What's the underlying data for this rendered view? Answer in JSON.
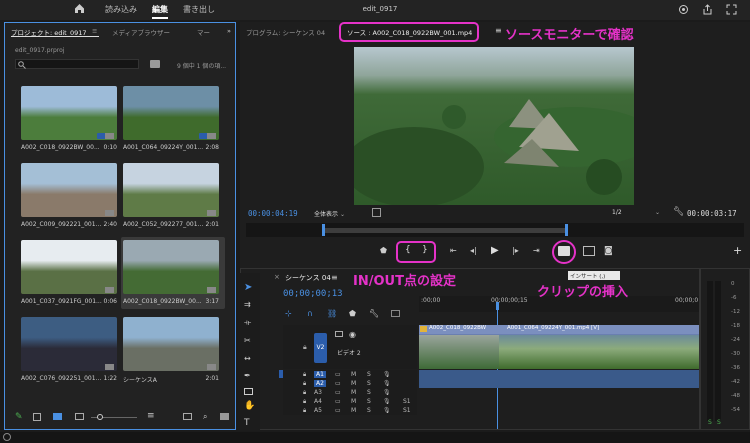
{
  "window": {
    "title": "edit_0917",
    "tabs": [
      "読み込み",
      "編集",
      "書き出し"
    ],
    "active_tab": 1
  },
  "project": {
    "tab_label": "プロジェクト: edit_0917",
    "media_browser": "メディアブラウザー",
    "more": "マー",
    "file": "edit_0917.prproj",
    "count": "9 個中 1 個の項...",
    "items": [
      {
        "name": "A002_C018_0922BW_00...",
        "dur": "0:10",
        "sky": "#9dbbd8",
        "ground": "#4c7d3c",
        "badge": true
      },
      {
        "name": "A001_C064_09224Y_001...",
        "dur": "2:08",
        "sky": "#6d8fa6",
        "ground": "#3f6b2c",
        "badge": true
      },
      {
        "name": "A002_C009_092221_001...",
        "dur": "2:40",
        "sky": "#a4bfd6",
        "ground": "#8a7a6a",
        "badge": false
      },
      {
        "name": "A002_C052_092277_001...",
        "dur": "2:01",
        "sky": "#c6d3e0",
        "ground": "#5f7b47",
        "badge": false
      },
      {
        "name": "A001_C037_0921FG_001...",
        "dur": "0:06",
        "sky": "#e7ecf0",
        "ground": "#5a7045",
        "badge": false
      },
      {
        "name": "A002_C018_0922BW_00...",
        "dur": "3:17",
        "sky": "#9aa9b2",
        "ground": "#446b34",
        "badge": false,
        "selected": true
      },
      {
        "name": "A002_C076_092251_001...",
        "dur": "1:22",
        "sky": "#3d5d82",
        "ground": "#2b2b38",
        "badge": false
      },
      {
        "name": "シーケンスA",
        "dur": "2:01",
        "sky": "#8fb1cf",
        "ground": "#6a6f64",
        "badge": false
      }
    ]
  },
  "program": {
    "label": "プログラム: シーケンス 04"
  },
  "source": {
    "label": "ソース : A002_C018_0922BW_001.mp4",
    "timecode": "00:00:04:19",
    "fit": "全体表示",
    "res": "1/2",
    "duration": "00:00:03:17"
  },
  "timeline": {
    "tab": "シーケンス 04",
    "timecode": "00;00;00;13",
    "ruler": [
      ":00;00",
      "00;00;00;15",
      "00;00;0"
    ],
    "v2": "V2",
    "video_label": "ビデオ 2",
    "clip1": "A002_C018_0922BW",
    "clip2": "A001_C064_09224Y_001.mp4 [V]",
    "a_tracks": [
      "A1",
      "A2",
      "A3",
      "A4",
      "A5"
    ],
    "src_a": "A1",
    "m": "M",
    "s": "S",
    "s1": "S1"
  },
  "tooltip": "インサート (,)",
  "meter": {
    "ticks": [
      "0",
      "-6",
      "-12",
      "-18",
      "-24",
      "-30",
      "-36",
      "-42",
      "-48",
      "-54"
    ],
    "solo": [
      "S",
      "S"
    ]
  },
  "annotations": {
    "source_monitor": "ソースモニターで確認",
    "inout": "IN/OUT点の設定",
    "insert": "クリップの挿入"
  }
}
